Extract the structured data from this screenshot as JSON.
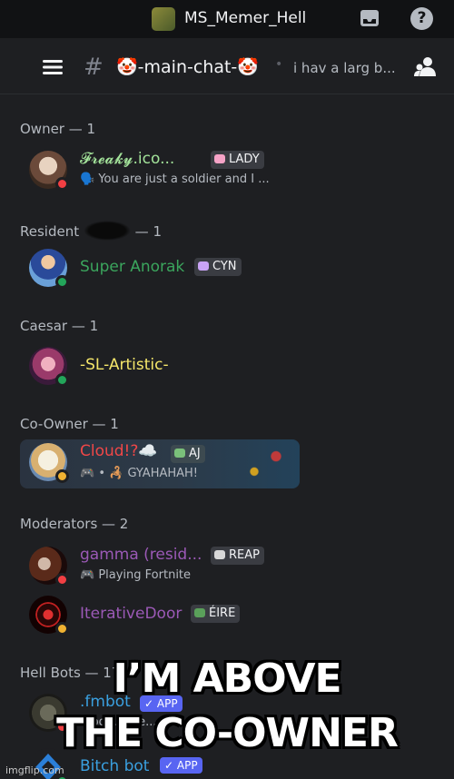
{
  "colors": {
    "background": "#1e1f22",
    "owner_name": "#a3e39a",
    "resident_name": "#3ba55d",
    "caesar_name": "#f5e66a",
    "coowner_name": "#f04747",
    "moderator_name": "#9b59b6",
    "bot_name": "#3aa0e0",
    "tag_bg": "#3a3c42",
    "bot_tag_bg": "#5865f2"
  },
  "topbar": {
    "server_name": "MS_Memer_Hell",
    "inbox_icon": "inbox-icon",
    "help_icon": "help-icon",
    "help_glyph": "?"
  },
  "header": {
    "channel_name": "🤡-main-chat-🤡",
    "hash_glyph": "#",
    "dot": "•",
    "topic": "i hav a larg b..."
  },
  "sections": {
    "owner": {
      "title": "Owner — 1"
    },
    "resident": {
      "title_prefix": "Resident",
      "title_suffix": "— 1"
    },
    "caesar": {
      "title": "Caesar — 1"
    },
    "coowner": {
      "title": "Co-Owner — 1"
    },
    "moderators": {
      "title": "Moderators — 2"
    },
    "bots": {
      "title": "Hell Bots — 17"
    }
  },
  "members": {
    "freaky": {
      "name": "𝓕𝓻𝓮𝓪𝓴𝔂.ico...",
      "status": "🗣️ You are just a soldier and I ...",
      "tag": "LADY",
      "presence": "dnd"
    },
    "anorak": {
      "name": "Super Anorak",
      "tag": "CYN",
      "presence": "online"
    },
    "artistic": {
      "name": "-SL-Artistic-",
      "presence": "online"
    },
    "cloud": {
      "name": "Cloud!?☁️",
      "status": "🎮 • 🦂 GYAHAHAH!",
      "tag": "AJ",
      "presence": "idle"
    },
    "gamma": {
      "name": "gamma (resid...",
      "status": "🎮 Playing Fortnite",
      "tag": "REAP",
      "presence": "dnd"
    },
    "iterative": {
      "name": "IterativeDoor",
      "tag": "ÉIRE",
      "presence": "idle"
    },
    "fmbot": {
      "name": ".fmbot",
      "status": "...bo... 7 se...",
      "tag": "✓ APP",
      "presence": "dnd"
    },
    "bitchbot": {
      "name": "Bitch bot",
      "tag": "✓ APP",
      "presence": "online"
    }
  },
  "caption": {
    "line1": "I’M ABOVE",
    "line2": "THE CO-OWNER"
  },
  "watermark": "imgflip.com"
}
